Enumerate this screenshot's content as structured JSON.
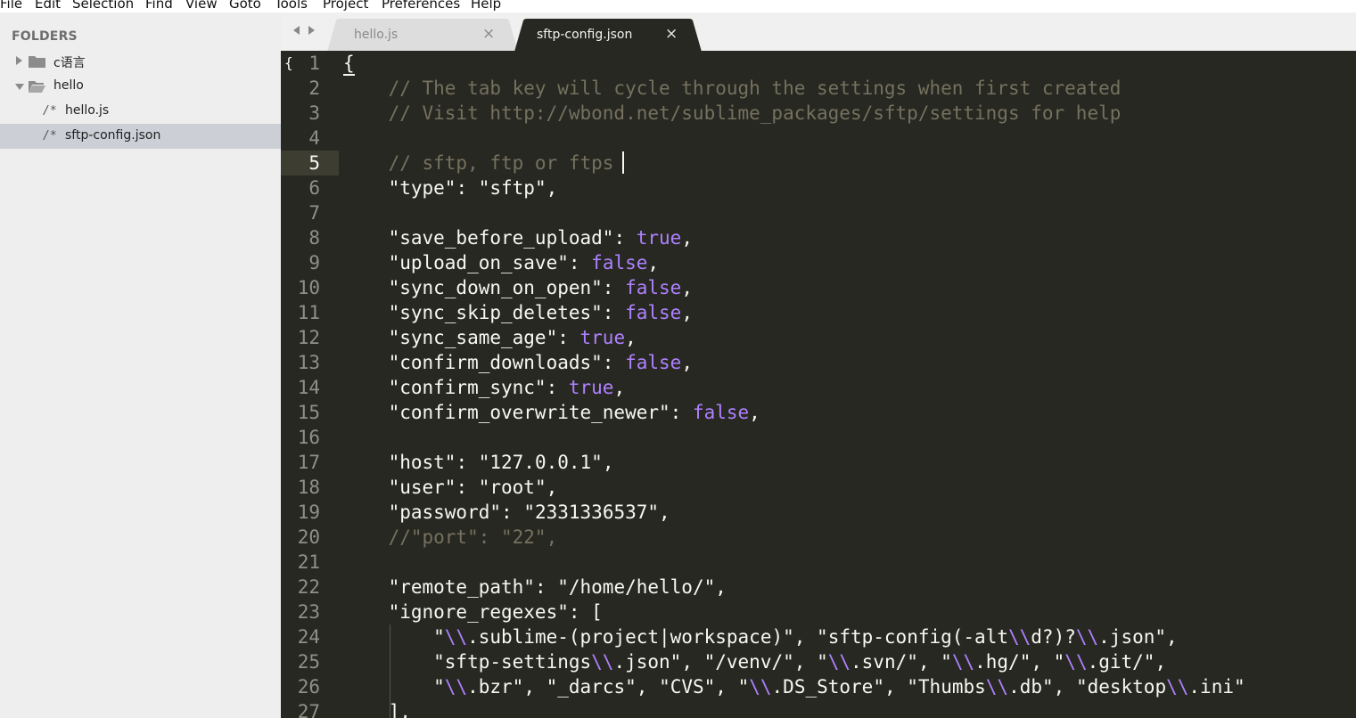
{
  "menu": [
    "File",
    "Edit",
    "Selection",
    "Find",
    "View",
    "Goto",
    "Tools",
    "Project",
    "Preferences",
    "Help"
  ],
  "sidebar": {
    "title": "FOLDERS",
    "items": [
      {
        "label": "c语言",
        "kind": "folder",
        "expanded": false,
        "selected": false
      },
      {
        "label": "hello",
        "kind": "folder",
        "expanded": true,
        "selected": false
      },
      {
        "label": "hello.js",
        "kind": "file",
        "icon_text": "/*",
        "selected": false
      },
      {
        "label": "sftp-config.json",
        "kind": "file",
        "icon_text": "/*",
        "selected": true
      }
    ]
  },
  "tabs": [
    {
      "label": "hello.js",
      "active": false,
      "close": "×"
    },
    {
      "label": "sftp-config.json",
      "active": true,
      "close": "×"
    }
  ],
  "editor": {
    "fold_marker": "{",
    "current_line": 5,
    "theme": {
      "background": "#272822",
      "comment": "#75715e",
      "constant": "#ae81ff",
      "text": "#f8f8f2"
    },
    "lines": [
      [
        [
          "p",
          "{"
        ]
      ],
      [
        [
          "c",
          "    // The tab key will cycle through the settings when first created"
        ]
      ],
      [
        [
          "c",
          "    // Visit http://wbond.net/sublime_packages/sftp/settings for help"
        ]
      ],
      [],
      [
        [
          "c",
          "    // sftp, ftp or ftps"
        ]
      ],
      [
        [
          "k",
          "    \"type\""
        ],
        [
          "p",
          ": "
        ],
        [
          "k",
          "\"sftp\""
        ],
        [
          "p",
          ","
        ]
      ],
      [],
      [
        [
          "k",
          "    \"save_before_upload\""
        ],
        [
          "p",
          ": "
        ],
        [
          "b",
          "true"
        ],
        [
          "p",
          ","
        ]
      ],
      [
        [
          "k",
          "    \"upload_on_save\""
        ],
        [
          "p",
          ": "
        ],
        [
          "b",
          "false"
        ],
        [
          "p",
          ","
        ]
      ],
      [
        [
          "k",
          "    \"sync_down_on_open\""
        ],
        [
          "p",
          ": "
        ],
        [
          "b",
          "false"
        ],
        [
          "p",
          ","
        ]
      ],
      [
        [
          "k",
          "    \"sync_skip_deletes\""
        ],
        [
          "p",
          ": "
        ],
        [
          "b",
          "false"
        ],
        [
          "p",
          ","
        ]
      ],
      [
        [
          "k",
          "    \"sync_same_age\""
        ],
        [
          "p",
          ": "
        ],
        [
          "b",
          "true"
        ],
        [
          "p",
          ","
        ]
      ],
      [
        [
          "k",
          "    \"confirm_downloads\""
        ],
        [
          "p",
          ": "
        ],
        [
          "b",
          "false"
        ],
        [
          "p",
          ","
        ]
      ],
      [
        [
          "k",
          "    \"confirm_sync\""
        ],
        [
          "p",
          ": "
        ],
        [
          "b",
          "true"
        ],
        [
          "p",
          ","
        ]
      ],
      [
        [
          "k",
          "    \"confirm_overwrite_newer\""
        ],
        [
          "p",
          ": "
        ],
        [
          "b",
          "false"
        ],
        [
          "p",
          ","
        ]
      ],
      [],
      [
        [
          "k",
          "    \"host\""
        ],
        [
          "p",
          ": "
        ],
        [
          "k",
          "\"127.0.0.1\""
        ],
        [
          "p",
          ","
        ]
      ],
      [
        [
          "k",
          "    \"user\""
        ],
        [
          "p",
          ": "
        ],
        [
          "k",
          "\"root\""
        ],
        [
          "p",
          ","
        ]
      ],
      [
        [
          "k",
          "    \"password\""
        ],
        [
          "p",
          ": "
        ],
        [
          "k",
          "\"2331336537\""
        ],
        [
          "p",
          ","
        ]
      ],
      [
        [
          "c",
          "    //\"port\": \"22\","
        ]
      ],
      [],
      [
        [
          "k",
          "    \"remote_path\""
        ],
        [
          "p",
          ": "
        ],
        [
          "k",
          "\"/home/hello/\""
        ],
        [
          "p",
          ","
        ]
      ],
      [
        [
          "k",
          "    \"ignore_regexes\""
        ],
        [
          "p",
          ": ["
        ]
      ],
      [
        [
          "k",
          "        \""
        ],
        [
          "e",
          "\\\\"
        ],
        [
          "k",
          ".sublime-(project|workspace)\""
        ],
        [
          "p",
          ", "
        ],
        [
          "k",
          "\"sftp-config(-alt"
        ],
        [
          "e",
          "\\\\"
        ],
        [
          "k",
          "d?)?"
        ],
        [
          "e",
          "\\\\"
        ],
        [
          "k",
          ".json\""
        ],
        [
          "p",
          ","
        ]
      ],
      [
        [
          "k",
          "        \"sftp-settings"
        ],
        [
          "e",
          "\\\\"
        ],
        [
          "k",
          ".json\""
        ],
        [
          "p",
          ", "
        ],
        [
          "k",
          "\"/venv/\""
        ],
        [
          "p",
          ", "
        ],
        [
          "k",
          "\""
        ],
        [
          "e",
          "\\\\"
        ],
        [
          "k",
          ".svn/\""
        ],
        [
          "p",
          ", "
        ],
        [
          "k",
          "\""
        ],
        [
          "e",
          "\\\\"
        ],
        [
          "k",
          ".hg/\""
        ],
        [
          "p",
          ", "
        ],
        [
          "k",
          "\""
        ],
        [
          "e",
          "\\\\"
        ],
        [
          "k",
          ".git/\""
        ],
        [
          "p",
          ","
        ]
      ],
      [
        [
          "k",
          "        \""
        ],
        [
          "e",
          "\\\\"
        ],
        [
          "k",
          ".bzr\""
        ],
        [
          "p",
          ", "
        ],
        [
          "k",
          "\"_darcs\""
        ],
        [
          "p",
          ", "
        ],
        [
          "k",
          "\"CVS\""
        ],
        [
          "p",
          ", "
        ],
        [
          "k",
          "\""
        ],
        [
          "e",
          "\\\\"
        ],
        [
          "k",
          ".DS_Store\""
        ],
        [
          "p",
          ", "
        ],
        [
          "k",
          "\"Thumbs"
        ],
        [
          "e",
          "\\\\"
        ],
        [
          "k",
          ".db\""
        ],
        [
          "p",
          ", "
        ],
        [
          "k",
          "\"desktop"
        ],
        [
          "e",
          "\\\\"
        ],
        [
          "k",
          ".ini\""
        ]
      ],
      [
        [
          "p",
          "    ],"
        ]
      ]
    ]
  }
}
